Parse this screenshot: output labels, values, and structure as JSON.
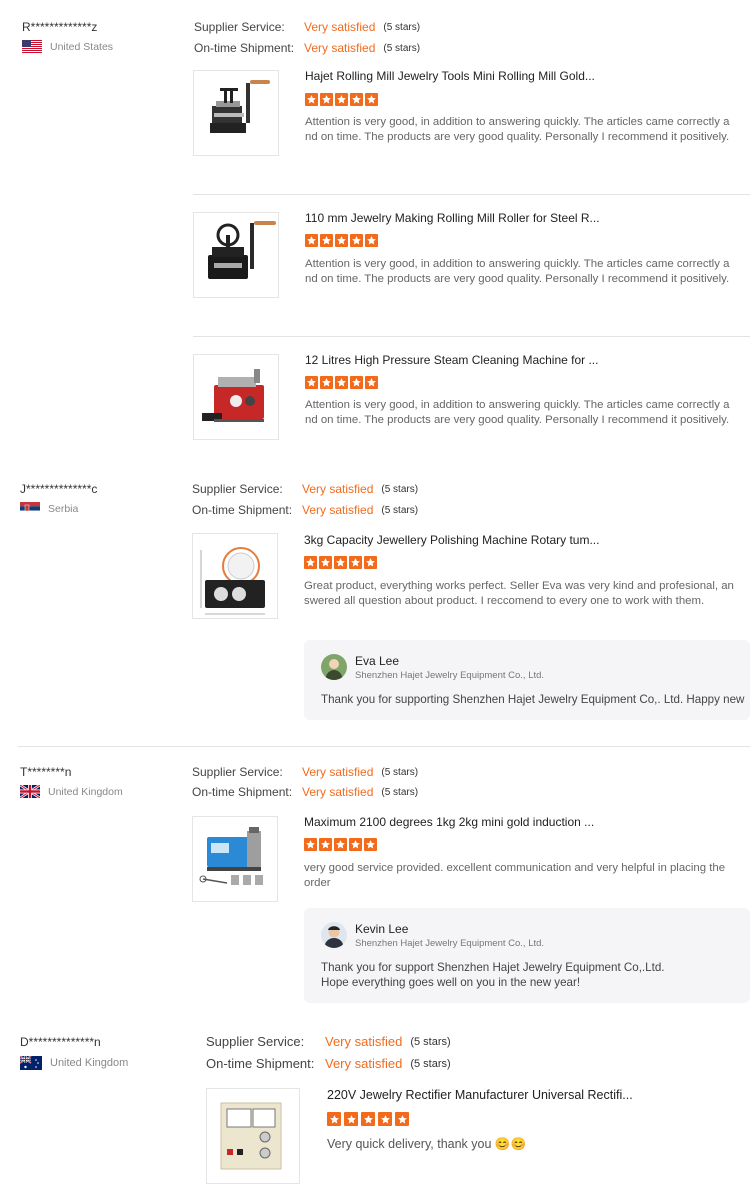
{
  "labels": {
    "supplier_service": "Supplier Service:",
    "ontime_shipment": "On-time Shipment:",
    "very_satisfied": "Very satisfied",
    "five_stars": "(5 stars)"
  },
  "colors": {
    "accent": "#f26b1d",
    "reply_bg": "#f5f5f7"
  },
  "reviews": [
    {
      "buyer": "R*************z",
      "country": "United States",
      "flag_icon": "us-flag-icon",
      "supplier_service": "Very satisfied",
      "supplier_stars": "(5 stars)",
      "shipment": "Very satisfied",
      "shipment_stars": "(5 stars)",
      "products": [
        {
          "title": "Hajet Rolling Mill Jewelry Tools Mini Rolling Mill Gold...",
          "rating": 5,
          "text": "Attention is very good, in addition to answering quickly. The articles came correctly and on time. The products are very good quality. Personally I recommend it positively."
        },
        {
          "title": "110 mm Jewelry Making Rolling Mill Roller for Steel R...",
          "rating": 5,
          "text": "Attention is very good, in addition to answering quickly. The articles came correctly and on time. The products are very good quality. Personally I recommend it positively."
        },
        {
          "title": "12 Litres High Pressure Steam Cleaning Machine for ...",
          "rating": 5,
          "text": "Attention is very good, in addition to answering quickly. The articles came correctly and on time. The products are very good quality. Personally I recommend it positively."
        }
      ]
    },
    {
      "buyer": "J**************c",
      "country": "Serbia",
      "flag_icon": "serbia-flag-icon",
      "supplier_service": "Very satisfied",
      "supplier_stars": "(5 stars)",
      "shipment": "Very satisfied",
      "shipment_stars": "(5 stars)",
      "products": [
        {
          "title": "3kg Capacity Jewellery Polishing Machine Rotary tum...",
          "rating": 5,
          "text": "Great product, everything works perfect. Seller Eva was very kind and profesional, answered all question about product. I reccomend to every one to work with them."
        }
      ],
      "reply": {
        "name": "Eva Lee",
        "company": "Shenzhen Hajet Jewelry Equipment Co., Ltd.",
        "text": "Thank you for supporting Shenzhen Hajet Jewelry Equipment Co,. Ltd. Happy new"
      }
    },
    {
      "buyer": "T********n",
      "country": "United Kingdom",
      "flag_icon": "uk-flag-icon",
      "supplier_service": "Very satisfied",
      "supplier_stars": "(5 stars)",
      "shipment": "Very satisfied",
      "shipment_stars": "(5 stars)",
      "products": [
        {
          "title": "Maximum 2100 degrees 1kg 2kg mini gold induction ...",
          "rating": 5,
          "text": "very good service provided. excellent communication and very helpful in placing the order"
        }
      ],
      "reply": {
        "name": "Kevin Lee",
        "company": "Shenzhen Hajet Jewelry Equipment Co., Ltd.",
        "text1": "Thank you for support Shenzhen Hajet Jewelry Equipment Co,.Ltd.",
        "text2": "Hope everything goes well on you in the new year!"
      }
    },
    {
      "buyer": "D**************n",
      "country": "United Kingdom",
      "flag_icon": "australia-flag-icon",
      "supplier_service": "Very satisfied",
      "supplier_stars": "(5 stars)",
      "shipment": "Very satisfied",
      "shipment_stars": "(5 stars)",
      "products": [
        {
          "title": "220V Jewelry Rectifier Manufacturer Universal Rectifi...",
          "rating": 5,
          "text": "Very quick delivery, thank you 😊😊"
        }
      ]
    }
  ]
}
